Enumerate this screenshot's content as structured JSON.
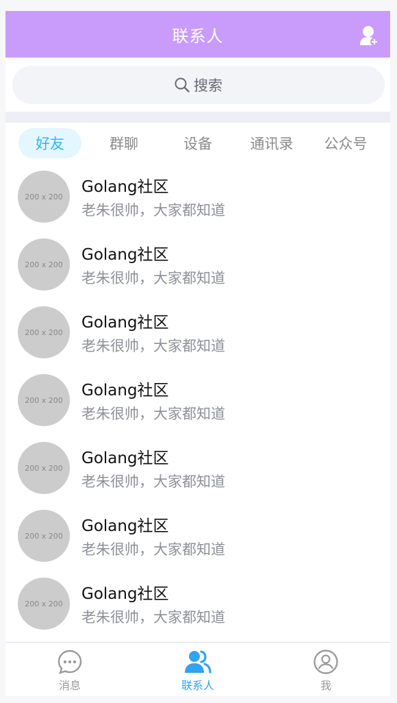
{
  "header": {
    "title": "联系人",
    "action_icon": "add-contact-icon"
  },
  "search": {
    "label": "搜索",
    "icon": "search-icon"
  },
  "tabs": [
    {
      "label": "好友",
      "active": true
    },
    {
      "label": "群聊",
      "active": false
    },
    {
      "label": "设备",
      "active": false
    },
    {
      "label": "通讯录",
      "active": false
    },
    {
      "label": "公众号",
      "active": false
    }
  ],
  "contacts": [
    {
      "avatar_text": "200 x 200",
      "name": "Golang社区",
      "desc": "老朱很帅，大家都知道"
    },
    {
      "avatar_text": "200 x 200",
      "name": "Golang社区",
      "desc": "老朱很帅，大家都知道"
    },
    {
      "avatar_text": "200 x 200",
      "name": "Golang社区",
      "desc": "老朱很帅，大家都知道"
    },
    {
      "avatar_text": "200 x 200",
      "name": "Golang社区",
      "desc": "老朱很帅，大家都知道"
    },
    {
      "avatar_text": "200 x 200",
      "name": "Golang社区",
      "desc": "老朱很帅，大家都知道"
    },
    {
      "avatar_text": "200 x 200",
      "name": "Golang社区",
      "desc": "老朱很帅，大家都知道"
    },
    {
      "avatar_text": "200 x 200",
      "name": "Golang社区",
      "desc": "老朱很帅，大家都知道"
    }
  ],
  "bottom_nav": [
    {
      "label": "消息",
      "icon": "chat-bubble-icon",
      "active": false
    },
    {
      "label": "联系人",
      "icon": "contacts-icon",
      "active": true
    },
    {
      "label": "我",
      "icon": "profile-icon",
      "active": false
    }
  ],
  "colors": {
    "header_bg": "#c99bfb",
    "accent": "#31b6ef",
    "active_tab_bg": "#e4f6ff",
    "avatar_placeholder": "#cccccc"
  }
}
